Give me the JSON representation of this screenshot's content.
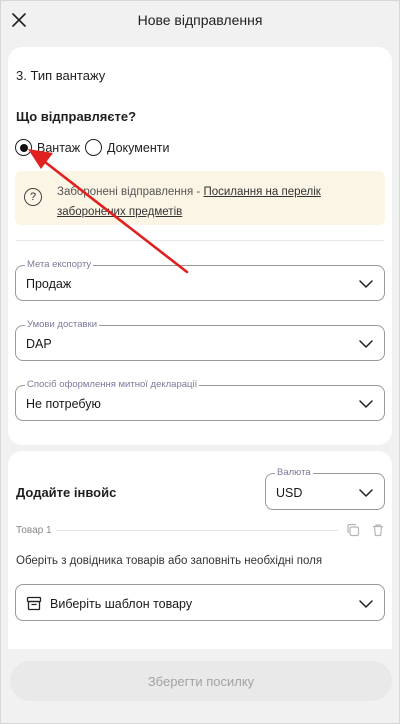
{
  "header": {
    "title": "Нове відправлення"
  },
  "cargo_section": {
    "title": "3. Тип вантажу",
    "question": "Що відправляєте?",
    "options": [
      {
        "label": "Вантаж",
        "selected": true
      },
      {
        "label": "Документи",
        "selected": false
      }
    ],
    "info": {
      "text": "Заборонені відправлення - ",
      "link": "Посилання на перелік заборонених предметів"
    },
    "fields": [
      {
        "legend": "Мета експорту",
        "value": "Продаж"
      },
      {
        "legend": "Умови доставки",
        "value": "DAP"
      },
      {
        "legend": "Спосіб оформлення митної декларації",
        "value": "Не потребую"
      }
    ]
  },
  "invoice": {
    "title": "Додайте інвойс",
    "currency": {
      "legend": "Валюта",
      "value": "USD"
    },
    "item_label": "Товар 1",
    "hint": "Оберіть з довідника товарів або заповніть необхідні поля",
    "template_select": "Виберіть шаблон товару"
  },
  "footer": {
    "save_label": "Зберегти посилку"
  },
  "colors": {
    "annotation_arrow": "#e0211f",
    "info_bg": "#fbf5e6"
  }
}
